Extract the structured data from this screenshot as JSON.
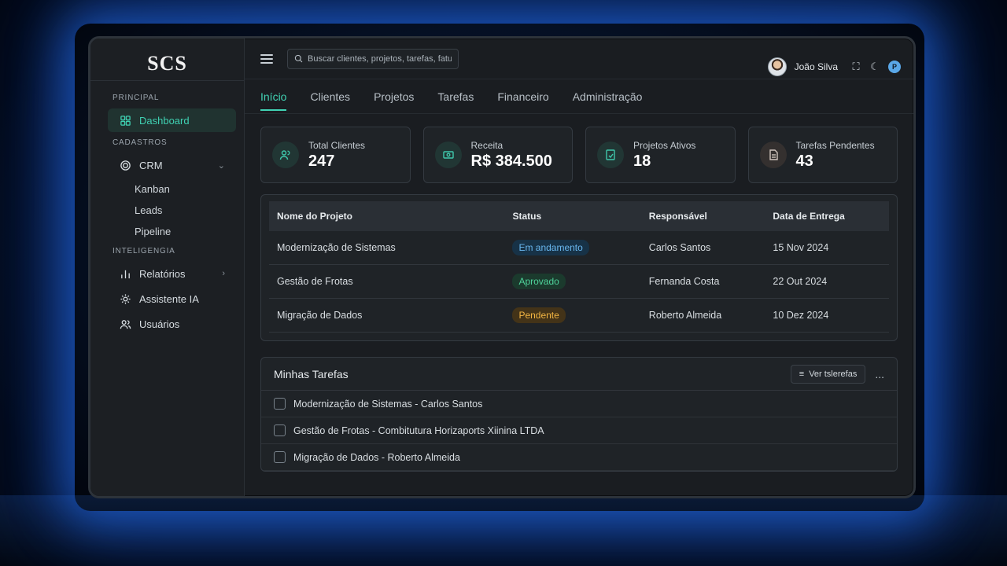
{
  "app": {
    "logo": "SCS"
  },
  "sidebar": {
    "sections": [
      {
        "title": "PRINCIPAL"
      },
      {
        "title": "CADASTROS"
      },
      {
        "title": "INTELIGENGIA"
      }
    ],
    "dashboard": {
      "label": "Dashboard",
      "icon": "grid-icon"
    },
    "crm": {
      "label": "CRM",
      "icon": "target-icon",
      "sub": [
        "Kanban",
        "Leads",
        "Pipeline"
      ]
    },
    "relatorios": {
      "label": "Relatórios",
      "icon": "bar-chart-icon"
    },
    "assistente": {
      "label": "Assistente IA",
      "icon": "gear-icon"
    },
    "usuarios": {
      "label": "Usuários",
      "icon": "users-icon"
    }
  },
  "topbar": {
    "search_placeholder": "Buscar clientes, projetos, tarefas, faturas",
    "user_name": "João Silva",
    "badge": "P"
  },
  "tabs": [
    "Início",
    "Clientes",
    "Projetos",
    "Tarefas",
    "Financeiro",
    "Administração"
  ],
  "cards": [
    {
      "label": "Total Clientes",
      "value": "247",
      "icon": "users-icon"
    },
    {
      "label": "Receita",
      "value": "R$ 384.500",
      "icon": "money-icon"
    },
    {
      "label": "Projetos Ativos",
      "value": "18",
      "icon": "file-icon"
    },
    {
      "label": "Tarefas Pendentes",
      "value": "43",
      "icon": "document-icon"
    }
  ],
  "projects": {
    "headers": [
      "Nome do Projeto",
      "Status",
      "Responsável",
      "Data de Entrega"
    ],
    "rows": [
      {
        "name": "Modernização de Sistemas",
        "status": "Em andamento",
        "owner": "Carlos Santos",
        "date": "15 Nov 2024"
      },
      {
        "name": "Gestão de Frotas",
        "status": "Aprovado",
        "owner": "Fernanda Costa",
        "date": "22 Out 2024"
      },
      {
        "name": "Migração de Dados",
        "status": "Pendente",
        "owner": "Roberto Almeida",
        "date": "10 Dez 2024"
      }
    ]
  },
  "tasks": {
    "title": "Minhas Tarefas",
    "button": "Ver tslerefas",
    "more": "...",
    "items": [
      "Modernização de Sistemas - Carlos Santos",
      "Gestão de Frotas - Combitutura Horizaports Xiinina LTDA",
      "Migração de Dados - Roberto Almeida"
    ]
  }
}
